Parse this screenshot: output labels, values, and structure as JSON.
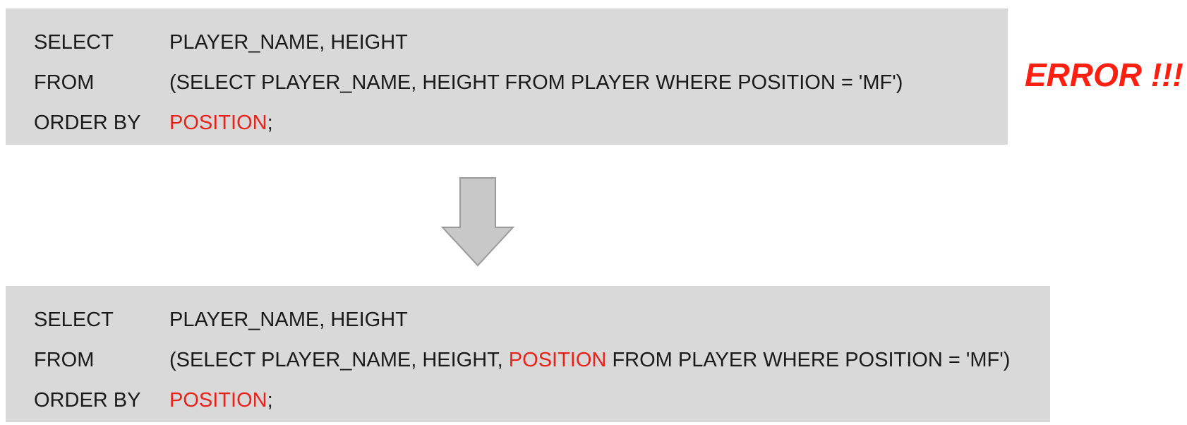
{
  "top_query": {
    "line1": {
      "keyword": "SELECT",
      "clause": "PLAYER_NAME, HEIGHT"
    },
    "line2": {
      "keyword": "FROM",
      "clause": "(SELECT PLAYER_NAME, HEIGHT FROM PLAYER WHERE POSITION = 'MF')"
    },
    "line3": {
      "keyword": "ORDER BY",
      "highlight": "POSITION",
      "suffix": ";"
    }
  },
  "error_label": "ERROR !!!",
  "arrow_icon": "down-arrow-icon",
  "bottom_query": {
    "line1": {
      "keyword": "SELECT",
      "clause": "PLAYER_NAME, HEIGHT"
    },
    "line2": {
      "keyword": "FROM",
      "clause_before": "(SELECT PLAYER_NAME, HEIGHT,",
      "highlight": "POSITION",
      "clause_after": "FROM PLAYER WHERE POSITION = 'MF')"
    },
    "line3": {
      "keyword": "ORDER BY",
      "highlight": "POSITION",
      "suffix": ";"
    }
  },
  "colors": {
    "box_background": "#d9d9d9",
    "highlight": "#e8231a",
    "error": "#ff1f10",
    "arrow_fill": "#c8c8c8",
    "arrow_stroke": "#9a9a9a"
  }
}
